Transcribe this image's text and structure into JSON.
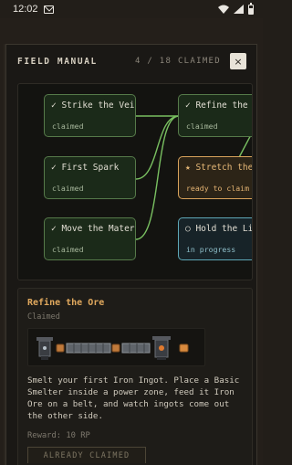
{
  "status_bar": {
    "time": "12:02",
    "icons": [
      "gmail-icon",
      "wifi-icon",
      "signal-icon",
      "battery-icon"
    ]
  },
  "modal": {
    "title": "FIELD MANUAL",
    "counter": "4 / 18 CLAIMED",
    "close_label": "×"
  },
  "quest_tree": {
    "nodes": [
      {
        "name": "✓ Strike the Vein",
        "state": "claimed",
        "status": "claimed"
      },
      {
        "name": "✓ First Spark",
        "state": "claimed",
        "status": "claimed"
      },
      {
        "name": "✓ Move the Materials",
        "state": "claimed",
        "status": "claimed"
      },
      {
        "name": "✓ Refine the Ore",
        "state": "claimed",
        "status": "claimed"
      },
      {
        "name": "★ Stretch the Line",
        "state": "ready to claim",
        "status": "claimable"
      },
      {
        "name": "○ Hold the Line",
        "state": "in progress",
        "status": "in-progress"
      }
    ],
    "colors": {
      "claimed_border": "#567a4a",
      "claimable_border": "#d9a35c",
      "in_progress_border": "#5ea7b6",
      "link": "#79c061"
    }
  },
  "detail": {
    "title": "Refine the Ore",
    "status": "Claimed",
    "description": "Smelt your first Iron Ingot. Place a Basic Smelter inside a power zone, feed it Iron Ore on a belt, and watch ingots come out the other side.",
    "reward": "Reward: 10 RP",
    "button_label": "ALREADY CLAIMED",
    "accent": "#e0a85d"
  }
}
